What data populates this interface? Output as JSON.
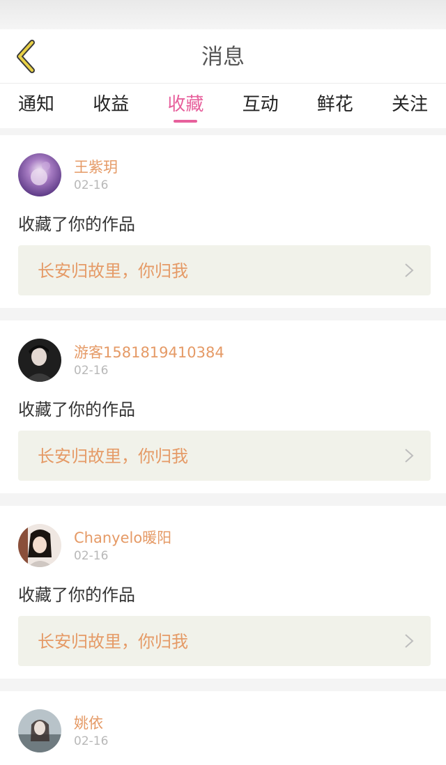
{
  "header": {
    "title": "消息"
  },
  "tabs": [
    {
      "label": "通知"
    },
    {
      "label": "收益"
    },
    {
      "label": "收藏"
    },
    {
      "label": "互动"
    },
    {
      "label": "鲜花"
    },
    {
      "label": "关注"
    }
  ],
  "active_tab": "收藏",
  "notifications": [
    {
      "username": "王紫玥",
      "date": "02-16",
      "action": "收藏了你的作品",
      "work_title": "长安归故里，你归我"
    },
    {
      "username": "游客1581819410384",
      "date": "02-16",
      "action": "收藏了你的作品",
      "work_title": "长安归故里，你归我"
    },
    {
      "username": "Chanyelo暖阳",
      "date": "02-16",
      "action": "收藏了你的作品",
      "work_title": "长安归故里，你归我"
    },
    {
      "username": "姚依",
      "date": "02-16"
    }
  ],
  "colors": {
    "accent_pink": "#e7609c",
    "username_orange": "#e59a66",
    "back_arrow_yellow": "#e8d046",
    "card_highlight_bg": "#f1f2ea"
  }
}
